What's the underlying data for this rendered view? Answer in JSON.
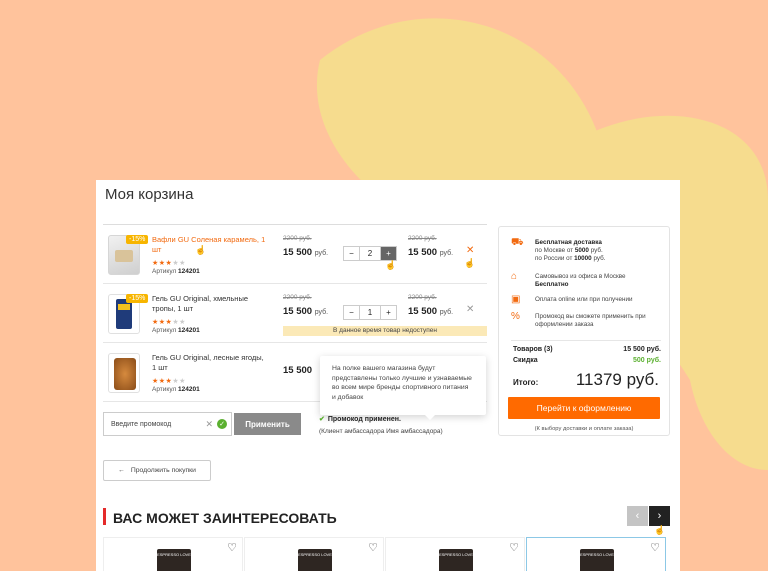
{
  "page_title": "Моя корзина",
  "cart_items": [
    {
      "name": "Вафли GU Соленая карамель, 1 шт",
      "badge": "-15%",
      "rating": 3,
      "sku_label": "Артикул",
      "sku": "124201",
      "old_price": "2200 руб.",
      "price": "15 500",
      "currency": "руб.",
      "qty": "2",
      "old_total": "2200 руб.",
      "total": "15 500"
    },
    {
      "name": "Гель GU Original, хмельные тропы, 1 шт",
      "badge": "-15%",
      "rating": 3,
      "sku_label": "Артикул",
      "sku": "124201",
      "old_price": "2200 руб.",
      "price": "15 500",
      "currency": "руб.",
      "qty": "1",
      "old_total": "2200 руб.",
      "total": "15 500",
      "warning": "В данное время товар недоступен"
    },
    {
      "name": "Гель GU Original, лесные ягоды, 1 шт",
      "rating": 3,
      "sku_label": "Артикул",
      "sku": "124201",
      "price": "15 500"
    }
  ],
  "tooltip": "На полке вашего магазина будут представлены только лучшие и узнаваемые во всем мире бренды спортивного питания и добавок",
  "promo": {
    "placeholder": "Введите промокод",
    "apply_label": "Применить",
    "applied_text": "Промокод применен.",
    "note": "(Клиент амбассадора Имя амбассадора)"
  },
  "continue_label": "Продолжить покупки",
  "summary": {
    "delivery_title": "Бесплатная доставка",
    "delivery_moscow_prefix": "по Москве от",
    "delivery_moscow_amount": "5000",
    "delivery_russia_prefix": "по России от",
    "delivery_russia_amount": "10000",
    "currency": "руб.",
    "pickup_line": "Самовывоз из офиса в Москве",
    "pickup_free": "Бесплатно",
    "payment": "Оплата online или при получении",
    "promo_hint": "Промокод вы сможете применить при оформлении заказа",
    "goods_label": "Товаров (3)",
    "goods_value": "15 500 руб.",
    "discount_label": "Скидка",
    "discount_value": "500 руб.",
    "total_label": "Итого:",
    "total_value": "11379 руб.",
    "checkout_label": "Перейти к оформлению",
    "checkout_note": "(К выбору доставки и оплате заказа)"
  },
  "recommend": {
    "title": "ВАС МОЖЕТ ЗАИНТЕРЕСОВАТЬ",
    "product_label": "ESPRESSO LOVE"
  },
  "colors": {
    "accent": "#ff6a00",
    "background": "#ffc39c",
    "shape": "#f6dc8e",
    "success": "#5bb030"
  }
}
